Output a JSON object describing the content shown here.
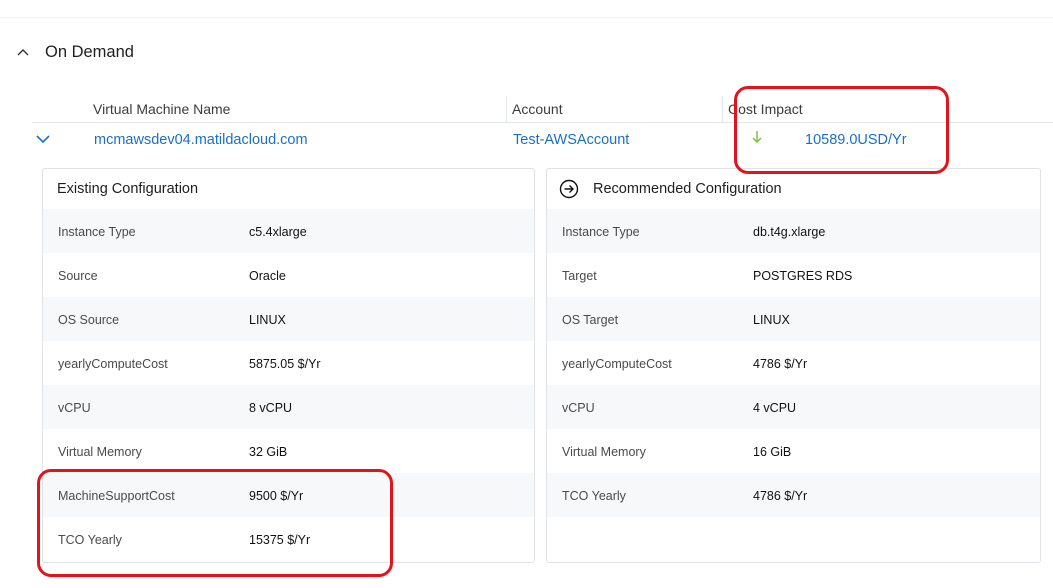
{
  "section": {
    "title": "On Demand"
  },
  "table": {
    "headers": {
      "vm_name": "Virtual Machine Name",
      "account": "Account",
      "cost_impact": "Cost Impact"
    },
    "row": {
      "vm_name": "mcmawsdev04.matildacloud.com",
      "account": "Test-AWSAccount",
      "cost_impact": "10589.0USD/Yr",
      "cost_direction": "down"
    }
  },
  "existing": {
    "title": "Existing Configuration",
    "items": [
      {
        "label": "Instance Type",
        "value": "c5.4xlarge"
      },
      {
        "label": "Source",
        "value": "Oracle"
      },
      {
        "label": "OS Source",
        "value": "LINUX"
      },
      {
        "label": "yearlyComputeCost",
        "value": "5875.05 $/Yr"
      },
      {
        "label": "vCPU",
        "value": "8 vCPU"
      },
      {
        "label": "Virtual Memory",
        "value": "32 GiB"
      },
      {
        "label": "MachineSupportCost",
        "value": "9500 $/Yr"
      },
      {
        "label": "TCO Yearly",
        "value": "15375 $/Yr"
      }
    ]
  },
  "recommended": {
    "title": "Recommended Configuration",
    "items": [
      {
        "label": "Instance Type",
        "value": "db.t4g.xlarge"
      },
      {
        "label": "Target",
        "value": "POSTGRES RDS"
      },
      {
        "label": "OS Target",
        "value": "LINUX"
      },
      {
        "label": "yearlyComputeCost",
        "value": "4786 $/Yr"
      },
      {
        "label": "vCPU",
        "value": "4 vCPU"
      },
      {
        "label": "Virtual Memory",
        "value": "16 GiB"
      },
      {
        "label": "TCO Yearly",
        "value": "4786 $/Yr"
      }
    ]
  },
  "colors": {
    "link": "#1a6fc9",
    "decrease": "#7cc443",
    "highlight": "#e1141d"
  },
  "icons": {
    "section_toggle": "chevron-up-icon",
    "row_expander": "chevron-down-icon",
    "cost_trend": "arrow-down-icon",
    "recommended": "circle-arrow-right-icon"
  }
}
